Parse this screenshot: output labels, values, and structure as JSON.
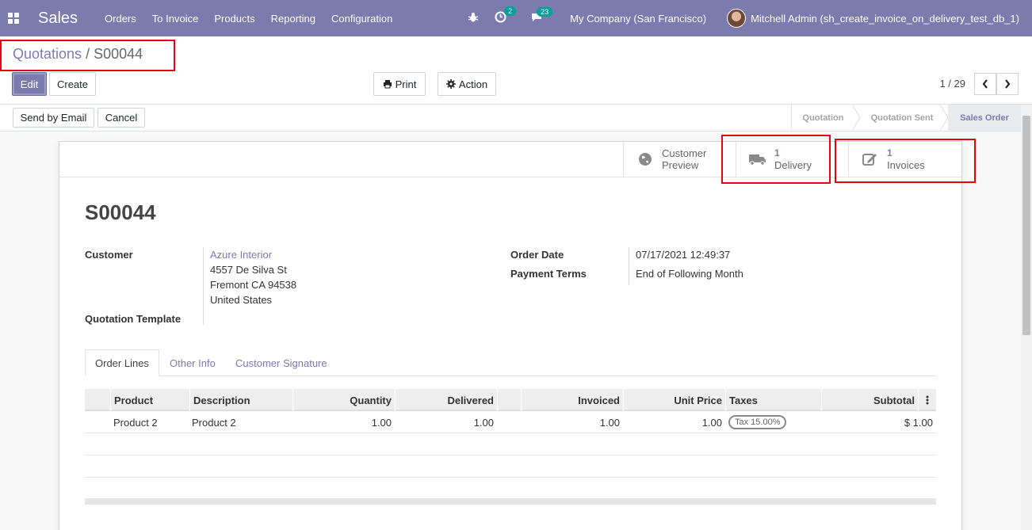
{
  "navbar": {
    "app_name": "Sales",
    "menu": [
      "Orders",
      "To Invoice",
      "Products",
      "Reporting",
      "Configuration"
    ],
    "activity_count": "2",
    "message_count": "23",
    "company": "My Company (San Francisco)",
    "user": "Mitchell Admin (sh_create_invoice_on_delivery_test_db_1)",
    "accent": "#7c7bad"
  },
  "breadcrumb": {
    "parent": "Quotations",
    "separator": "/",
    "current": "S00044"
  },
  "toolbar": {
    "edit": "Edit",
    "create": "Create",
    "print": "Print",
    "action": "Action",
    "pager": "1 / 29"
  },
  "statusbar": {
    "send_email": "Send by Email",
    "cancel": "Cancel",
    "stages": [
      "Quotation",
      "Quotation Sent",
      "Sales Order"
    ],
    "active_stage": "Sales Order"
  },
  "smart_buttons": {
    "preview_line1": "Customer",
    "preview_line2": "Preview",
    "delivery_count": "1",
    "delivery_label": "Delivery",
    "invoices_count": "1",
    "invoices_label": "Invoices"
  },
  "form": {
    "title": "S00044",
    "customer_label": "Customer",
    "customer_name": "Azure Interior",
    "address_line1": "4557 De Silva St",
    "address_line2": "Fremont CA 94538",
    "address_line3": "United States",
    "template_label": "Quotation Template",
    "order_date_label": "Order Date",
    "order_date": "07/17/2021 12:49:37",
    "payment_terms_label": "Payment Terms",
    "payment_terms": "End of Following Month"
  },
  "tabs": [
    "Order Lines",
    "Other Info",
    "Customer Signature"
  ],
  "order_lines": {
    "headers": [
      "Product",
      "Description",
      "Quantity",
      "Delivered",
      "Invoiced",
      "Unit Price",
      "Taxes",
      "Subtotal"
    ],
    "rows": [
      {
        "product": "Product 2",
        "description": "Product 2",
        "quantity": "1.00",
        "delivered": "1.00",
        "invoiced": "1.00",
        "unit_price": "1.00",
        "taxes": "Tax 15.00%",
        "subtotal": "$ 1.00"
      }
    ]
  }
}
